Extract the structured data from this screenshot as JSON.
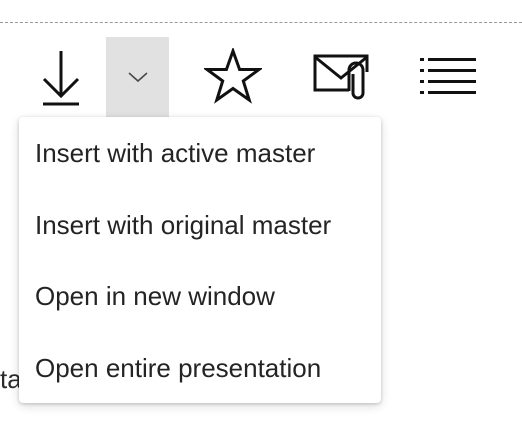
{
  "toolbar": {
    "icons": [
      "download-icon",
      "chevron-down-icon",
      "star-icon",
      "mail-attachment-icon",
      "list-icon"
    ],
    "dropdown_active_bg": "#e1e1e1"
  },
  "background_text": {
    "partial": "ta"
  },
  "menu": {
    "items": [
      {
        "label": "Insert with active master"
      },
      {
        "label": "Insert with original master"
      },
      {
        "label": "Open in new window"
      },
      {
        "label": "Open entire presentation"
      }
    ]
  }
}
